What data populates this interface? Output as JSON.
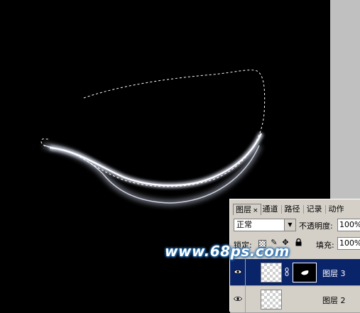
{
  "panel": {
    "tabs": [
      {
        "label": "图层",
        "active": true,
        "close": "×"
      },
      {
        "label": "通道",
        "active": false
      },
      {
        "label": "路径",
        "active": false
      },
      {
        "label": "记录",
        "active": false
      },
      {
        "label": "动作",
        "active": false
      }
    ],
    "blend_mode": "正常",
    "opacity_label": "不透明度:",
    "opacity_value": "100%",
    "lock_label": "锁定:",
    "fill_label": "填充:",
    "fill_value": "100%",
    "layers": [
      {
        "name": "图层 3",
        "selected": true,
        "visible": true,
        "has_mask": true
      },
      {
        "name": "图层 2",
        "selected": false,
        "visible": true,
        "has_mask": false
      }
    ]
  },
  "watermark": "www.68ps.com",
  "colors": {
    "canvas": "#000000",
    "selection_accent": "#0a246a",
    "panel_bg": "#d4d0c8",
    "watermark_glow": "#2a6fb0"
  }
}
